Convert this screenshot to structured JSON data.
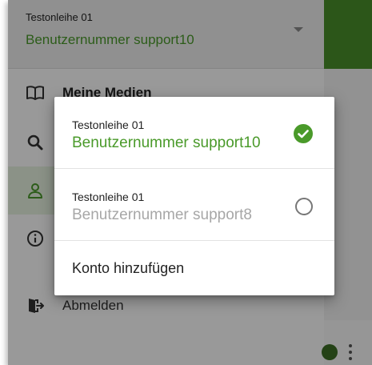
{
  "drawer": {
    "header": {
      "label": "Testonleihe 01",
      "value": "Benutzernummer support10"
    },
    "items": [
      {
        "label": "Meine Medien",
        "icon": "open-book-icon"
      },
      {
        "label": "",
        "icon": "search-icon"
      },
      {
        "label": "",
        "icon": "person-icon"
      },
      {
        "label": "",
        "icon": "info-icon"
      },
      {
        "label": "Abmelden",
        "icon": "logout-door-icon"
      }
    ]
  },
  "dialog": {
    "accounts": [
      {
        "label": "Testonleihe 01",
        "value": "Benutzernummer support10",
        "selected": true
      },
      {
        "label": "Testonleihe 01",
        "value": "Benutzernummer support8",
        "selected": false
      }
    ],
    "add_account_label": "Konto hinzufügen"
  },
  "colors": {
    "accent": "#4a9a2a",
    "check_fill": "#4a9a2a",
    "scrim": "rgba(0,0,0,0.40)"
  }
}
